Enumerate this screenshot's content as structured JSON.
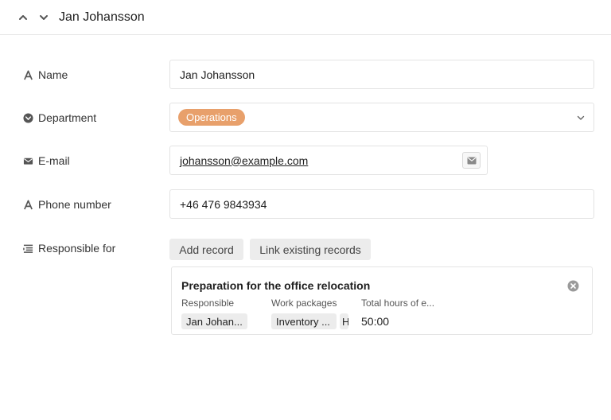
{
  "header": {
    "title": "Jan Johansson"
  },
  "fields": {
    "name": {
      "label": "Name",
      "value": "Jan Johansson"
    },
    "department": {
      "label": "Department",
      "value": "Operations",
      "tag_color": "#e8a06b"
    },
    "email": {
      "label": "E-mail",
      "value": "johansson@example.com"
    },
    "phone": {
      "label": "Phone number",
      "value": "+46 476 9843934"
    },
    "responsible": {
      "label": "Responsible for",
      "add_label": "Add record",
      "link_label": "Link existing records",
      "record": {
        "title": "Preparation for the office relocation",
        "columns": [
          "Responsible",
          "Work packages",
          "Total hours of e..."
        ],
        "responsible_chip": "Jan Johan...",
        "work_package_chip": "Inventory ...",
        "work_package_chip_2": "H",
        "hours": "50:00"
      }
    }
  }
}
